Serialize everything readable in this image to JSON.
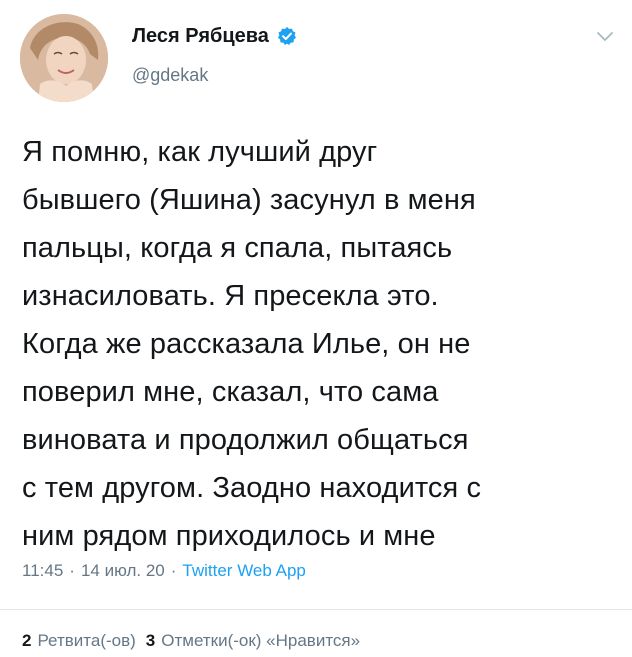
{
  "tweet": {
    "author": {
      "display_name": "Леся Рябцева",
      "handle": "@gdekak",
      "verified": true
    },
    "text": "Я помню, как лучший друг\nбывшего (Яшина) засунул в меня\nпальцы, когда я спала, пытаясь\nизнасиловать. Я пресекла это.\nКогда же рассказала Илье, он не\nповерил мне, сказал, что сама\nвиновата и продолжил общаться\nс тем другом. Заодно находится с\nним рядом приходилось и мне",
    "meta": {
      "time": "11:45",
      "date": "14 июл. 20",
      "separator": "·",
      "source": "Twitter Web App"
    },
    "stats": {
      "retweets_count": "2",
      "retweets_label": "Ретвита(-ов)",
      "likes_count": "3",
      "likes_label": "Отметки(-ок) «Нравится»"
    }
  },
  "colors": {
    "text": "#14171a",
    "secondary": "#657786",
    "accent": "#1da1f2",
    "divider": "#e1e8ed"
  },
  "icons": {
    "verified": "verified-badge-icon",
    "menu": "chevron-down-icon"
  }
}
